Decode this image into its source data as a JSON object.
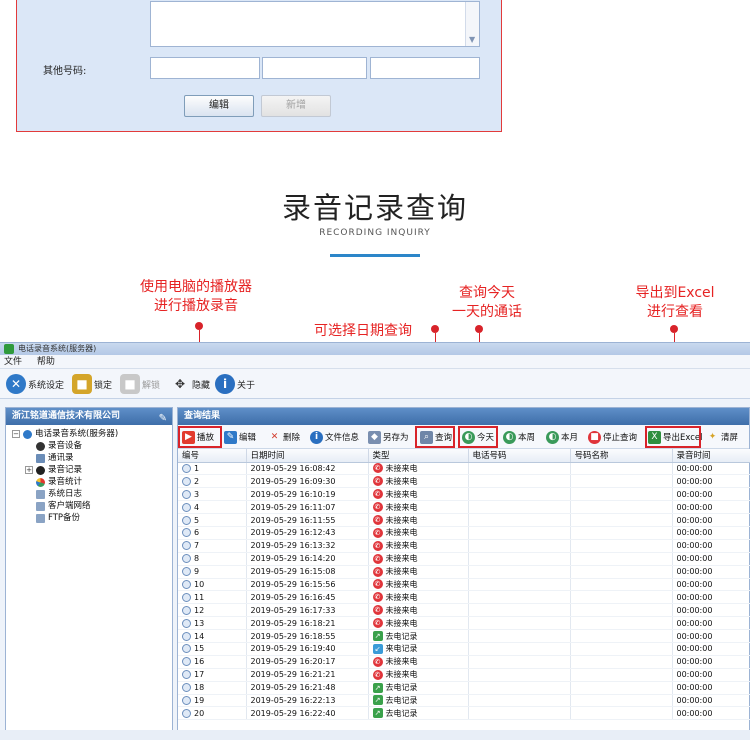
{
  "form": {
    "other_numbers_label": "其他号码:",
    "edit_button": "编辑",
    "add_button": "新增"
  },
  "heading": {
    "title": "录音记录查询",
    "subtitle": "RECORDING INQUIRY"
  },
  "annotations": {
    "play": [
      "使用电脑的播放器",
      "进行播放录音"
    ],
    "date_query": "可选择日期查询",
    "today": [
      "查询今天",
      "一天的通话"
    ],
    "export": [
      "导出到Excel",
      "进行查看"
    ]
  },
  "window": {
    "title": "电话录音系统(服务器)",
    "menu": [
      "文件",
      "帮助"
    ],
    "toolbar": [
      {
        "label": "系统设定",
        "icon": "settings-icon",
        "color": "#2f79c8"
      },
      {
        "label": "锁定",
        "icon": "lock-icon",
        "color": "#d4a52a"
      },
      {
        "label": "解锁",
        "icon": "unlock-icon",
        "color": "#c8c8c8"
      },
      {
        "label": "隐藏",
        "icon": "move-icon",
        "color": "#333333"
      },
      {
        "label": "关于",
        "icon": "info-icon",
        "color": "#2a6fc0"
      }
    ]
  },
  "left_pane": {
    "company": "浙江铭道通信技术有限公司",
    "tree": [
      {
        "label": "电话录音系统(服务器)",
        "level": 0,
        "icon": "system-icon",
        "color": "#2f79c8"
      },
      {
        "label": "录音设备",
        "level": 1,
        "icon": "device-icon",
        "color": "#333333"
      },
      {
        "label": "通讯录",
        "level": 1,
        "icon": "contacts-icon",
        "color": "#6b8db8"
      },
      {
        "label": "录音记录",
        "level": 1,
        "icon": "records-icon",
        "color": "#222222"
      },
      {
        "label": "录音统计",
        "level": 1,
        "icon": "stats-icon",
        "color": "#e2382f"
      },
      {
        "label": "系统日志",
        "level": 1,
        "icon": "log-icon",
        "color": "#8aa3c4"
      },
      {
        "label": "客户端网络",
        "level": 1,
        "icon": "network-icon",
        "color": "#8aa3c4"
      },
      {
        "label": "FTP备份",
        "level": 1,
        "icon": "ftp-icon",
        "color": "#8aa3c4"
      }
    ]
  },
  "right_pane": {
    "title": "查询结果",
    "toolbar": [
      {
        "label": "播放",
        "icon": "play-icon",
        "color": "#e23b2f"
      },
      {
        "label": "编辑",
        "icon": "edit-icon",
        "color": "#2f79c8"
      },
      {
        "label": "删除",
        "icon": "delete-icon",
        "color": "#d23a2a"
      },
      {
        "label": "文件信息",
        "icon": "info-icon",
        "color": "#2a6fc0"
      },
      {
        "label": "另存为",
        "icon": "save-as-icon",
        "color": "#7a8fb0"
      },
      {
        "label": "查询",
        "icon": "search-icon",
        "color": "#6f86a8"
      },
      {
        "label": "今天",
        "icon": "today-icon",
        "color": "#3a9a5a"
      },
      {
        "label": "本周",
        "icon": "week-icon",
        "color": "#3a9a5a"
      },
      {
        "label": "本月",
        "icon": "month-icon",
        "color": "#3a9a5a"
      },
      {
        "label": "停止查询",
        "icon": "stop-icon",
        "color": "#e0343a"
      },
      {
        "label": "导出Excel",
        "icon": "excel-icon",
        "color": "#2f8f3f"
      },
      {
        "label": "清屏",
        "icon": "broom-icon",
        "color": "#d6a428"
      }
    ],
    "columns": [
      "编号",
      "日期时间",
      "类型",
      "电话号码",
      "号码名称",
      "录音时间"
    ],
    "rows": [
      {
        "id": "1",
        "datetime": "2019-05-29 16:08:42",
        "type": "未接来电",
        "kind": "missed",
        "phone": "",
        "name": "",
        "duration": "00:00:00"
      },
      {
        "id": "2",
        "datetime": "2019-05-29 16:09:30",
        "type": "未接来电",
        "kind": "missed",
        "phone": "",
        "name": "",
        "duration": "00:00:00"
      },
      {
        "id": "3",
        "datetime": "2019-05-29 16:10:19",
        "type": "未接来电",
        "kind": "missed",
        "phone": "",
        "name": "",
        "duration": "00:00:00"
      },
      {
        "id": "4",
        "datetime": "2019-05-29 16:11:07",
        "type": "未接来电",
        "kind": "missed",
        "phone": "",
        "name": "",
        "duration": "00:00:00"
      },
      {
        "id": "5",
        "datetime": "2019-05-29 16:11:55",
        "type": "未接来电",
        "kind": "missed",
        "phone": "",
        "name": "",
        "duration": "00:00:00"
      },
      {
        "id": "6",
        "datetime": "2019-05-29 16:12:43",
        "type": "未接来电",
        "kind": "missed",
        "phone": "",
        "name": "",
        "duration": "00:00:00"
      },
      {
        "id": "7",
        "datetime": "2019-05-29 16:13:32",
        "type": "未接来电",
        "kind": "missed",
        "phone": "",
        "name": "",
        "duration": "00:00:00"
      },
      {
        "id": "8",
        "datetime": "2019-05-29 16:14:20",
        "type": "未接来电",
        "kind": "missed",
        "phone": "",
        "name": "",
        "duration": "00:00:00"
      },
      {
        "id": "9",
        "datetime": "2019-05-29 16:15:08",
        "type": "未接来电",
        "kind": "missed",
        "phone": "",
        "name": "",
        "duration": "00:00:00"
      },
      {
        "id": "10",
        "datetime": "2019-05-29 16:15:56",
        "type": "未接来电",
        "kind": "missed",
        "phone": "",
        "name": "",
        "duration": "00:00:00"
      },
      {
        "id": "11",
        "datetime": "2019-05-29 16:16:45",
        "type": "未接来电",
        "kind": "missed",
        "phone": "",
        "name": "",
        "duration": "00:00:00"
      },
      {
        "id": "12",
        "datetime": "2019-05-29 16:17:33",
        "type": "未接来电",
        "kind": "missed",
        "phone": "",
        "name": "",
        "duration": "00:00:00"
      },
      {
        "id": "13",
        "datetime": "2019-05-29 16:18:21",
        "type": "未接来电",
        "kind": "missed",
        "phone": "",
        "name": "",
        "duration": "00:00:00"
      },
      {
        "id": "14",
        "datetime": "2019-05-29 16:18:55",
        "type": "去电记录",
        "kind": "out",
        "phone": "",
        "name": "",
        "duration": "00:00:00"
      },
      {
        "id": "15",
        "datetime": "2019-05-29 16:19:40",
        "type": "来电记录",
        "kind": "in",
        "phone": "",
        "name": "",
        "duration": "00:00:00"
      },
      {
        "id": "16",
        "datetime": "2019-05-29 16:20:17",
        "type": "未接来电",
        "kind": "missed",
        "phone": "",
        "name": "",
        "duration": "00:00:00"
      },
      {
        "id": "17",
        "datetime": "2019-05-29 16:21:21",
        "type": "未接来电",
        "kind": "missed",
        "phone": "",
        "name": "",
        "duration": "00:00:00"
      },
      {
        "id": "18",
        "datetime": "2019-05-29 16:21:48",
        "type": "去电记录",
        "kind": "out",
        "phone": "",
        "name": "",
        "duration": "00:00:00"
      },
      {
        "id": "19",
        "datetime": "2019-05-29 16:22:13",
        "type": "去电记录",
        "kind": "out",
        "phone": "",
        "name": "",
        "duration": "00:00:00"
      },
      {
        "id": "20",
        "datetime": "2019-05-29 16:22:40",
        "type": "去电记录",
        "kind": "out",
        "phone": "",
        "name": "",
        "duration": "00:00:00"
      }
    ]
  },
  "colors": {
    "annotation": "#e62323",
    "accent_blue": "#2c86c9",
    "pane_header": "#3e6ea9"
  }
}
